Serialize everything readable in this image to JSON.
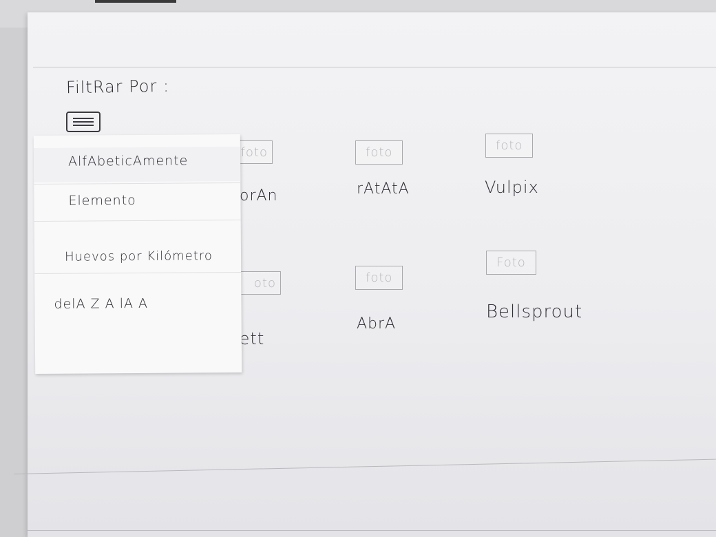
{
  "filter": {
    "label": "FiltRar Por :"
  },
  "dropdown": {
    "options": [
      {
        "label": "AlfAbeticAmente"
      },
      {
        "label": "Elemento"
      },
      {
        "label": "Huevos por Kilómetro"
      },
      {
        "label": "delA Z A lA A"
      }
    ]
  },
  "cards": [
    {
      "photo": "foto",
      "name": "orAn"
    },
    {
      "photo": "foto",
      "name": "rAtAtA"
    },
    {
      "photo": "foto",
      "name": "Vulpix"
    },
    {
      "photo": "oto",
      "name": "lett"
    },
    {
      "photo": "foto",
      "name": "AbrA"
    },
    {
      "photo": "Foto",
      "name": "Bellsprout"
    }
  ]
}
